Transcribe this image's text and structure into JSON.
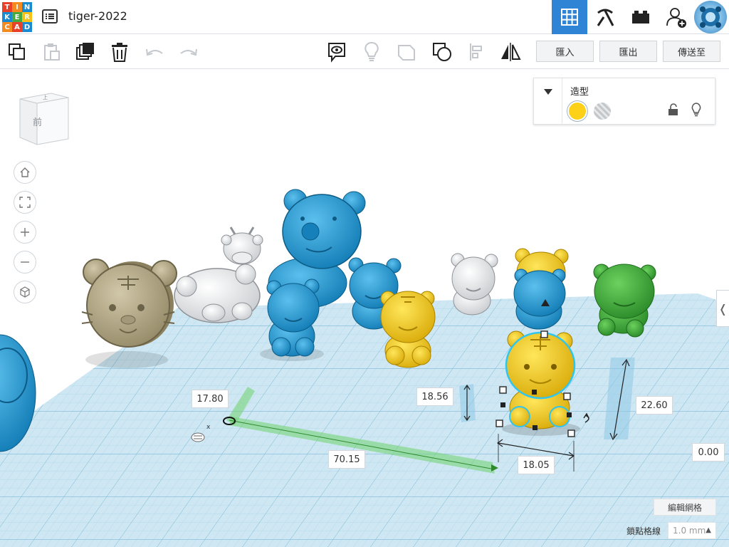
{
  "app": {
    "logo_letters": [
      "T",
      "I",
      "N",
      "K",
      "E",
      "R",
      "C",
      "A",
      "D"
    ],
    "design_title": "tiger-2022"
  },
  "toolbar": {
    "import_label": "匯入",
    "export_label": "匯出",
    "send_to_label": "傳送至"
  },
  "viewcube": {
    "face_label": "前"
  },
  "inspector": {
    "title": "造型",
    "selected_color": "#fcd118"
  },
  "dimensions": {
    "x_offset": "70.15",
    "y_offset": "17.80",
    "height_readout": "18.56",
    "width": "18.05",
    "total_height": "22.60",
    "elevation": "0.00"
  },
  "grid": {
    "edit_grid_label": "編輯網格",
    "snap_label": "鎖點格線",
    "snap_value": "1.0 mm"
  },
  "colors": {
    "accent": "#2f84d6",
    "tiger_blue": "#1c8fcc",
    "tiger_yellow": "#f5ce1d",
    "tiger_green": "#3ea83a",
    "tiger_white": "#e9eaec",
    "tiger_tan": "#b7ad8c",
    "workplane": "#cfe7f3"
  }
}
